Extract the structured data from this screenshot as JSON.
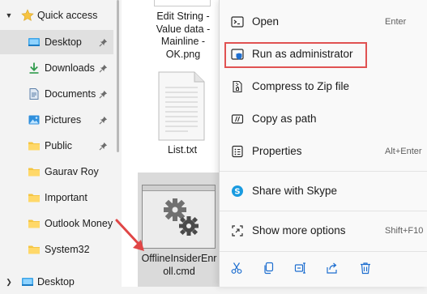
{
  "sidebar": {
    "quick_access": "Quick access",
    "items": [
      {
        "label": "Desktop",
        "icon": "desktop-folder-icon",
        "pinned": true,
        "selected": true
      },
      {
        "label": "Downloads",
        "icon": "download-arrow-icon",
        "pinned": true
      },
      {
        "label": "Documents",
        "icon": "documents-icon",
        "pinned": true
      },
      {
        "label": "Pictures",
        "icon": "pictures-icon",
        "pinned": true
      },
      {
        "label": "Public",
        "icon": "folder-icon",
        "pinned": true
      },
      {
        "label": "Gaurav Roy",
        "icon": "folder-icon"
      },
      {
        "label": "Important",
        "icon": "folder-icon"
      },
      {
        "label": "Outlook Money",
        "icon": "folder-icon"
      },
      {
        "label": "System32",
        "icon": "folder-icon"
      }
    ],
    "desktop_root": "Desktop"
  },
  "files": [
    {
      "name_lines": [
        "Edit String -",
        "Value data -",
        "Mainline -",
        "OK.png"
      ]
    },
    {
      "name_lines": [
        "List.txt"
      ]
    },
    {
      "name_lines": [
        "OfflineInsiderEnr",
        "oll.cmd"
      ],
      "selected": true
    }
  ],
  "context_menu": {
    "items": [
      {
        "label": "Open",
        "shortcut": "Enter",
        "icon": "open-cmd-icon"
      },
      {
        "label": "Run as administrator",
        "shortcut": "",
        "icon": "shield-icon",
        "highlighted": true
      },
      {
        "label": "Compress to Zip file",
        "shortcut": "",
        "icon": "zip-icon"
      },
      {
        "label": "Copy as path",
        "shortcut": "",
        "icon": "copy-path-icon"
      },
      {
        "label": "Properties",
        "shortcut": "Alt+Enter",
        "icon": "properties-icon"
      },
      {
        "label": "Share with Skype",
        "shortcut": "",
        "icon": "skype-icon"
      },
      {
        "label": "Show more options",
        "shortcut": "Shift+F10",
        "icon": "more-options-icon"
      }
    ],
    "actions": [
      "cut-icon",
      "copy-icon",
      "rename-icon",
      "share-icon",
      "delete-icon"
    ]
  },
  "colors": {
    "accent": "#0067c0",
    "highlight_box": "#e05252",
    "folder": "#f4c542",
    "skype": "#1a9be0"
  }
}
